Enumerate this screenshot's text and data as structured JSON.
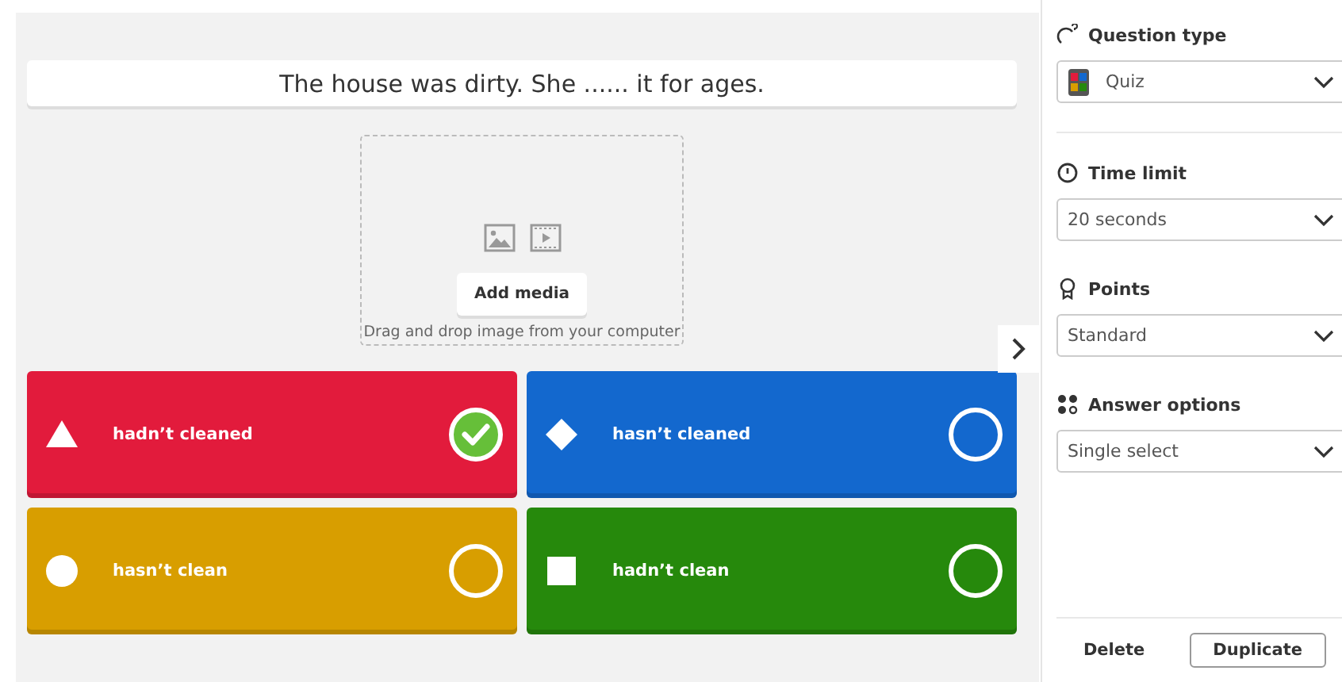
{
  "question": {
    "text": "The house was dirty. She ...... it for ages."
  },
  "media": {
    "button": "Add media",
    "hint": "Drag and drop image from your computer"
  },
  "answers": [
    {
      "text": "hadn’t cleaned",
      "kind": "triangle",
      "color": "#e21b3c",
      "correct": true
    },
    {
      "text": "hasn’t cleaned",
      "kind": "diamond",
      "color": "#1368ce",
      "correct": false
    },
    {
      "text": "hasn’t clean",
      "kind": "circle",
      "color": "#d89e00",
      "correct": false
    },
    {
      "text": "hadn’t clean",
      "kind": "square",
      "color": "#26890c",
      "correct": false
    }
  ],
  "sidebar": {
    "sections": [
      {
        "kind": "type",
        "label": "Question type",
        "value": "Quiz",
        "divider": true
      },
      {
        "kind": "time",
        "label": "Time limit",
        "value": "20 seconds",
        "divider": false
      },
      {
        "kind": "points",
        "label": "Points",
        "value": "Standard",
        "divider": false
      },
      {
        "kind": "options",
        "label": "Answer options",
        "value": "Single select",
        "divider": false
      }
    ],
    "buttons": [
      "Delete",
      "Duplicate"
    ]
  }
}
